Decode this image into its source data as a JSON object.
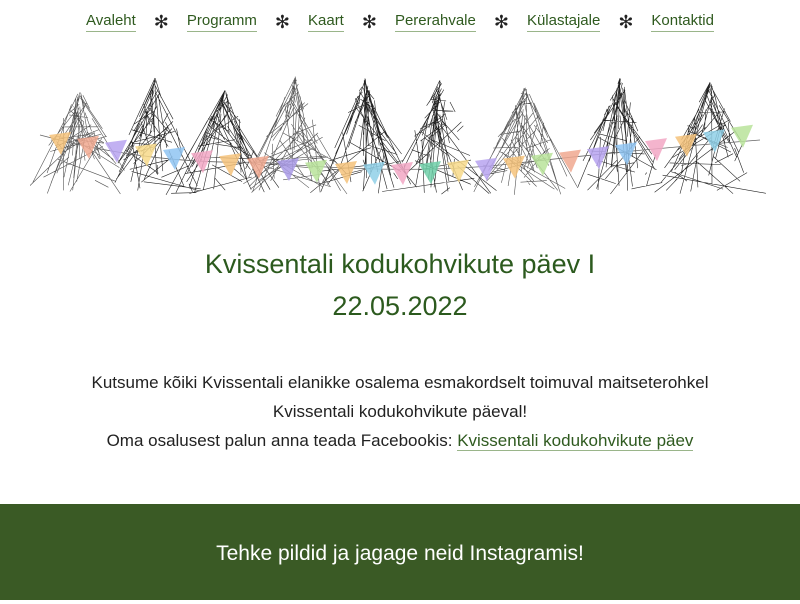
{
  "nav": {
    "items": [
      {
        "label": "Avaleht"
      },
      {
        "label": "Programm"
      },
      {
        "label": "Kaart"
      },
      {
        "label": "Pererahvale"
      },
      {
        "label": "Külastajale"
      },
      {
        "label": "Kontaktid"
      }
    ],
    "separator": "✻"
  },
  "hero": {
    "pennant_colors": [
      "#f5c27a",
      "#f0a88f",
      "#b7a3f0",
      "#f7d98a",
      "#8fc4f2",
      "#f2a7c4",
      "#f5c27a",
      "#f0a88f",
      "#a99ae6",
      "#b8e39a",
      "#f5c27a",
      "#8fd0e8",
      "#f2a7c4",
      "#6fcfa8",
      "#f7d98a",
      "#b7a3f0",
      "#f5c27a",
      "#b8e39a",
      "#f0a88f",
      "#b7a3f0",
      "#8fc4f2",
      "#f2a7c4",
      "#f5c27a",
      "#8fd0e8",
      "#b8e39a"
    ]
  },
  "main": {
    "title_line1": "Kvissentali kodukohvikute päev I",
    "title_line2": "22.05.2022",
    "intro_line1": "Kutsume kõiki Kvissentali elanikke osalema esmakordselt toimuval maitseterohkel",
    "intro_line2": "Kvissentali kodukohvikute päeval!",
    "facebook_prefix": "Oma osalusest palun anna teada Facebookis:",
    "facebook_link": "Kvissentali kodukohvikute päev"
  },
  "footer": {
    "text": "Tehke pildid ja jagage neid Instagramis!"
  }
}
